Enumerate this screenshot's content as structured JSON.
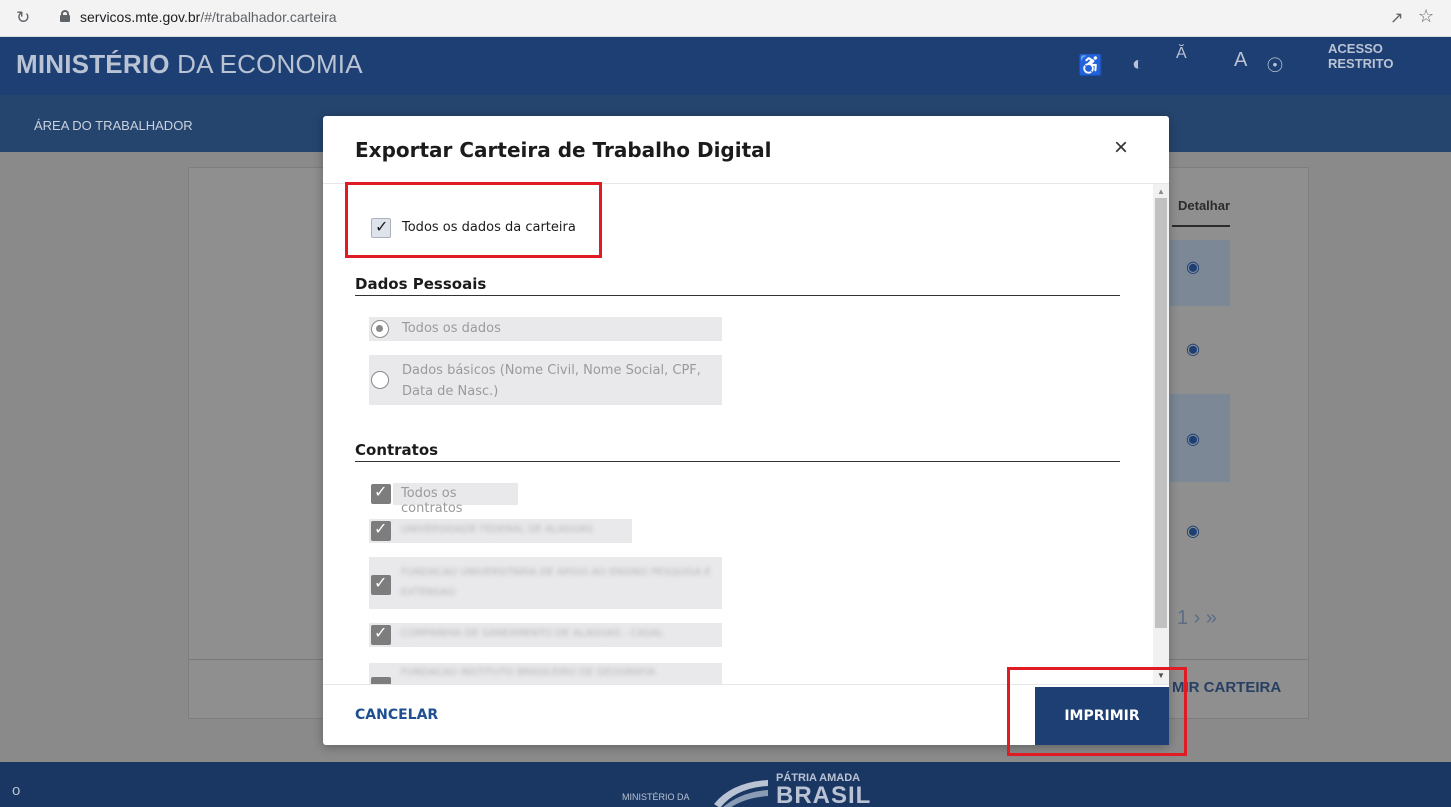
{
  "browser": {
    "url_host": "servicos.mte.gov.br",
    "url_path": "/#/trabalhador.carteira"
  },
  "site": {
    "title_bold": "MINISTÉRIO",
    "title_rest": " DA ECONOMIA",
    "acesso_restrito": "ACESSO RESTRITO",
    "nav_item": "ÁREA DO TRABALHADOR",
    "col_detalhar": "Detalhar",
    "pager": "1 › »",
    "print_link": "MIR CARTEIRA",
    "footer_o": "o",
    "footer_ministerio": "MINISTÉRIO DA",
    "footer_patria": "PÁTRIA AMADA",
    "footer_brasil": "BRASIL"
  },
  "modal": {
    "title": "Exportar Carteira de Trabalho Digital",
    "close_glyph": "×",
    "all_data_label": "Todos os dados da carteira",
    "check_glyph": "✓",
    "section_personal": "Dados Pessoais",
    "personal_options": [
      "Todos os dados",
      "Dados básicos (Nome Civil, Nome Social, CPF, Data de Nasc.)"
    ],
    "section_contracts": "Contratos",
    "contract_all": "Todos os contratos",
    "contract_items_obscured": [
      "UNIVERSIDADE FEDERAL DE ALAGOAS",
      "FUNDACAO UNIVERSITARIA DE APOIO AO ENSINO PESQUISA E EXTENSAO",
      "COMPANHIA DE SANEAMENTO DE ALAGOAS - CASAL",
      "FUNDACAO INSTITUTO BRASILEIRO DE GEOGRAFIA"
    ],
    "cancel_label": "CANCELAR",
    "print_label": "IMPRIMIR"
  },
  "colors": {
    "header_blue": "#1d3f73",
    "highlight_red": "#e01b24",
    "link_blue": "#1d4f91"
  }
}
